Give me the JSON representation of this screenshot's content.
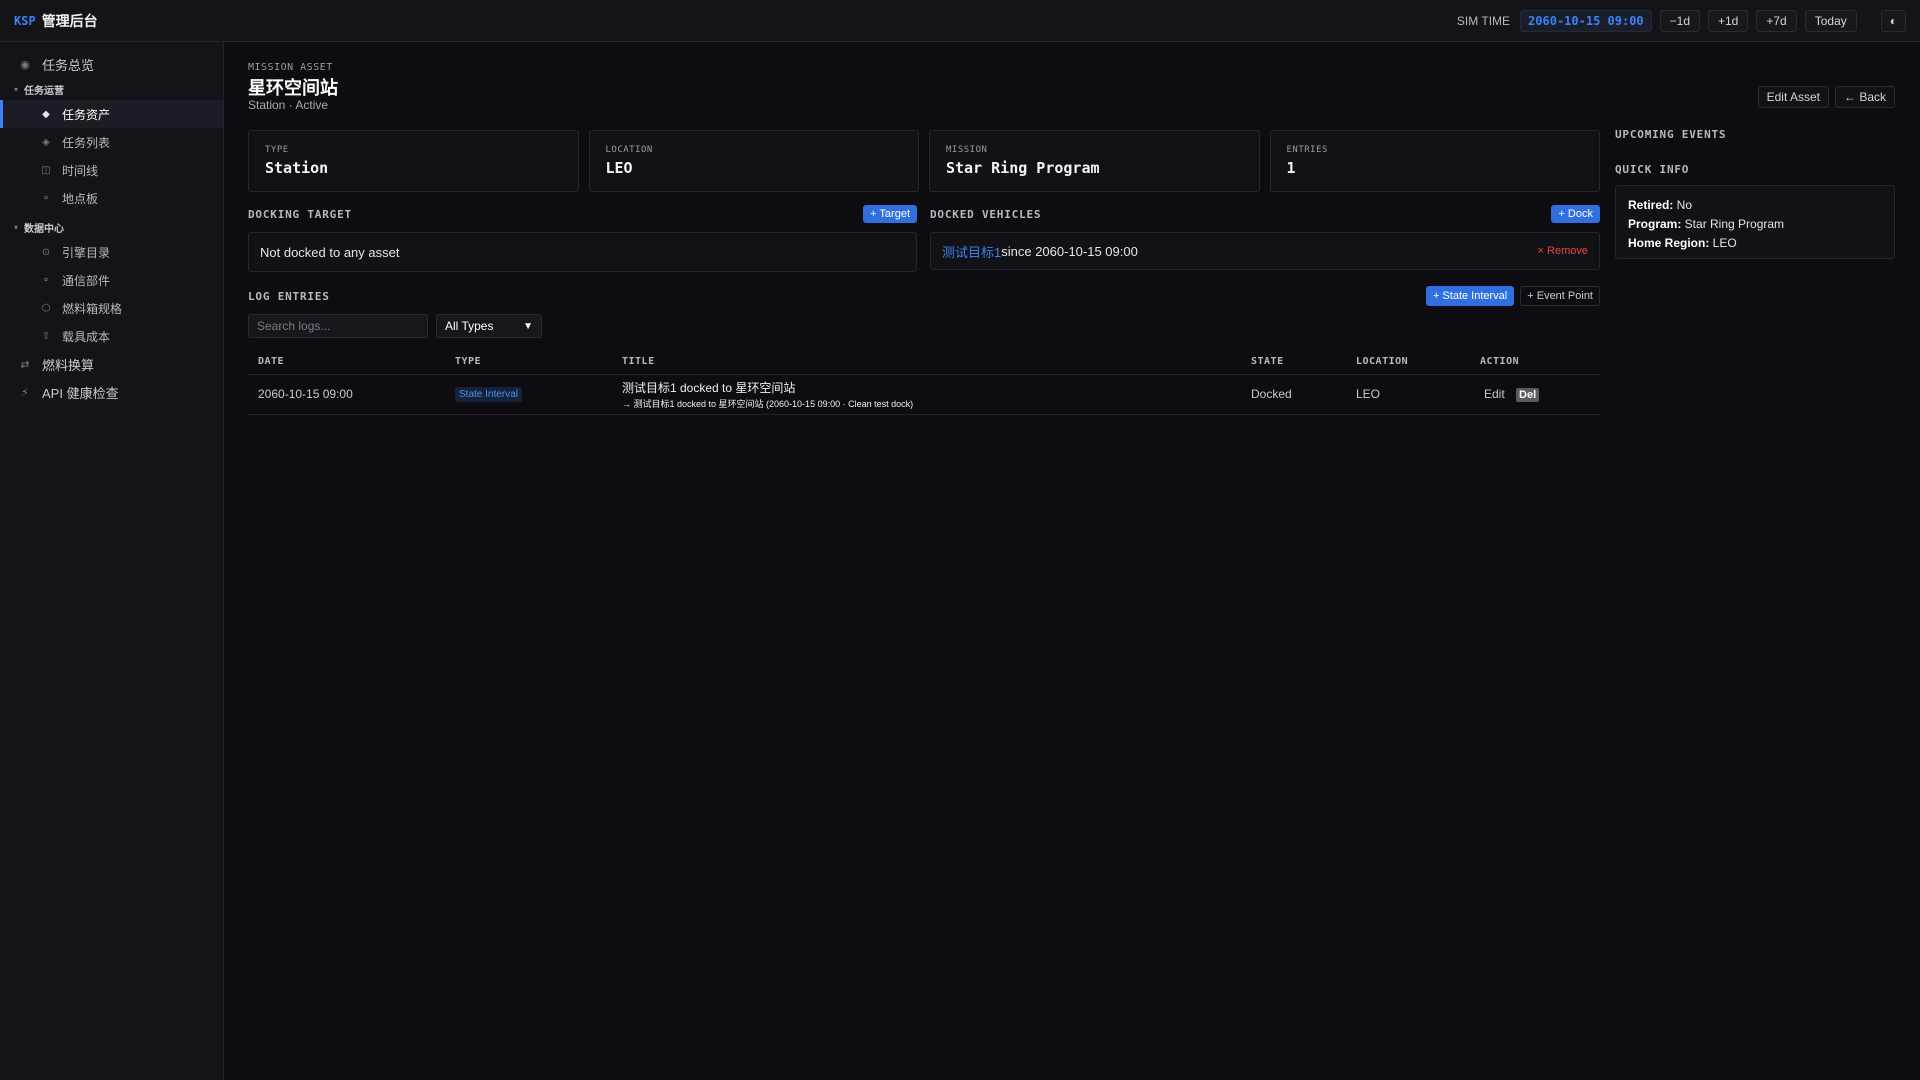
{
  "topbar": {
    "brand_code": "KSP",
    "brand_title": "管理后台",
    "sim_label": "SIM TIME",
    "sim_time": "2060-10-15 09:00",
    "buttons": [
      "−1d",
      "+1d",
      "+7d",
      "Today"
    ],
    "theme_icon": "◐"
  },
  "sidebar": {
    "overview": {
      "label": "任务总览",
      "icon": "◉"
    },
    "group_ops": {
      "label": "任务运营",
      "caret": "▾"
    },
    "ops_items": [
      {
        "label": "任务资产",
        "icon": "◆",
        "active": true
      },
      {
        "label": "任务列表",
        "icon": "◈"
      },
      {
        "label": "时间线",
        "icon": "◫"
      },
      {
        "label": "地点板",
        "icon": "⚬"
      }
    ],
    "group_data": {
      "label": "数据中心",
      "caret": "▾"
    },
    "data_items": [
      {
        "label": "引擎目录",
        "icon": "⊙"
      },
      {
        "label": "通信部件",
        "icon": "⚬"
      },
      {
        "label": "燃料箱规格",
        "icon": "⬡"
      },
      {
        "label": "载具成本",
        "icon": "⇧"
      }
    ],
    "fuel_calc": {
      "label": "燃料换算",
      "icon": "⇄"
    },
    "api_health": {
      "label": "API 健康检查",
      "icon": "⚡"
    }
  },
  "header": {
    "eyebrow": "MISSION ASSET",
    "title": "星环空间站",
    "subtitle": "Station · Active"
  },
  "cards": [
    {
      "label": "TYPE",
      "value": "Station"
    },
    {
      "label": "LOCATION",
      "value": "LEO"
    },
    {
      "label": "MISSION",
      "value": "Star Ring Program"
    },
    {
      "label": "ENTRIES",
      "value": "1"
    }
  ],
  "docking_target": {
    "label": "DOCKING TARGET",
    "button": "+ Target",
    "text": "Not docked to any asset"
  },
  "docked_vehicles": {
    "label": "DOCKED VEHICLES",
    "button": "+ Dock",
    "vehicle_link": "测试目标1",
    "vehicle_since": " since 2060-10-15 09:00",
    "remove_label": "× Remove"
  },
  "log": {
    "label": "LOG ENTRIES",
    "btn_state_interval": "+ State Interval",
    "btn_event_point": "+ Event Point",
    "search_placeholder": "Search logs...",
    "filter_value": "All Types",
    "columns": [
      "DATE",
      "TYPE",
      "TITLE",
      "STATE",
      "LOCATION",
      "ACTION"
    ],
    "rows": [
      {
        "date": "2060-10-15 09:00",
        "type": "State Interval",
        "title": "测试目标1 docked to 星环空间站",
        "detail": "→ 测试目标1 docked to 星环空间站 (2060-10-15 09:00 · Clean test dock)",
        "state": "Docked",
        "location": "LEO",
        "edit": "Edit",
        "del": "Del"
      }
    ]
  },
  "right": {
    "edit_asset": "Edit Asset",
    "back": "← Back",
    "upcoming_label": "UPCOMING EVENTS",
    "quick_info_label": "QUICK INFO",
    "quick_info": [
      {
        "key": "Retired:",
        "value": " No"
      },
      {
        "key": "Program:",
        "value": " Star Ring Program"
      },
      {
        "key": "Home Region:",
        "value": " LEO"
      }
    ]
  },
  "colors": {
    "accent": "#3b82f6",
    "danger": "#ef4444",
    "background": "#0d0d11"
  }
}
